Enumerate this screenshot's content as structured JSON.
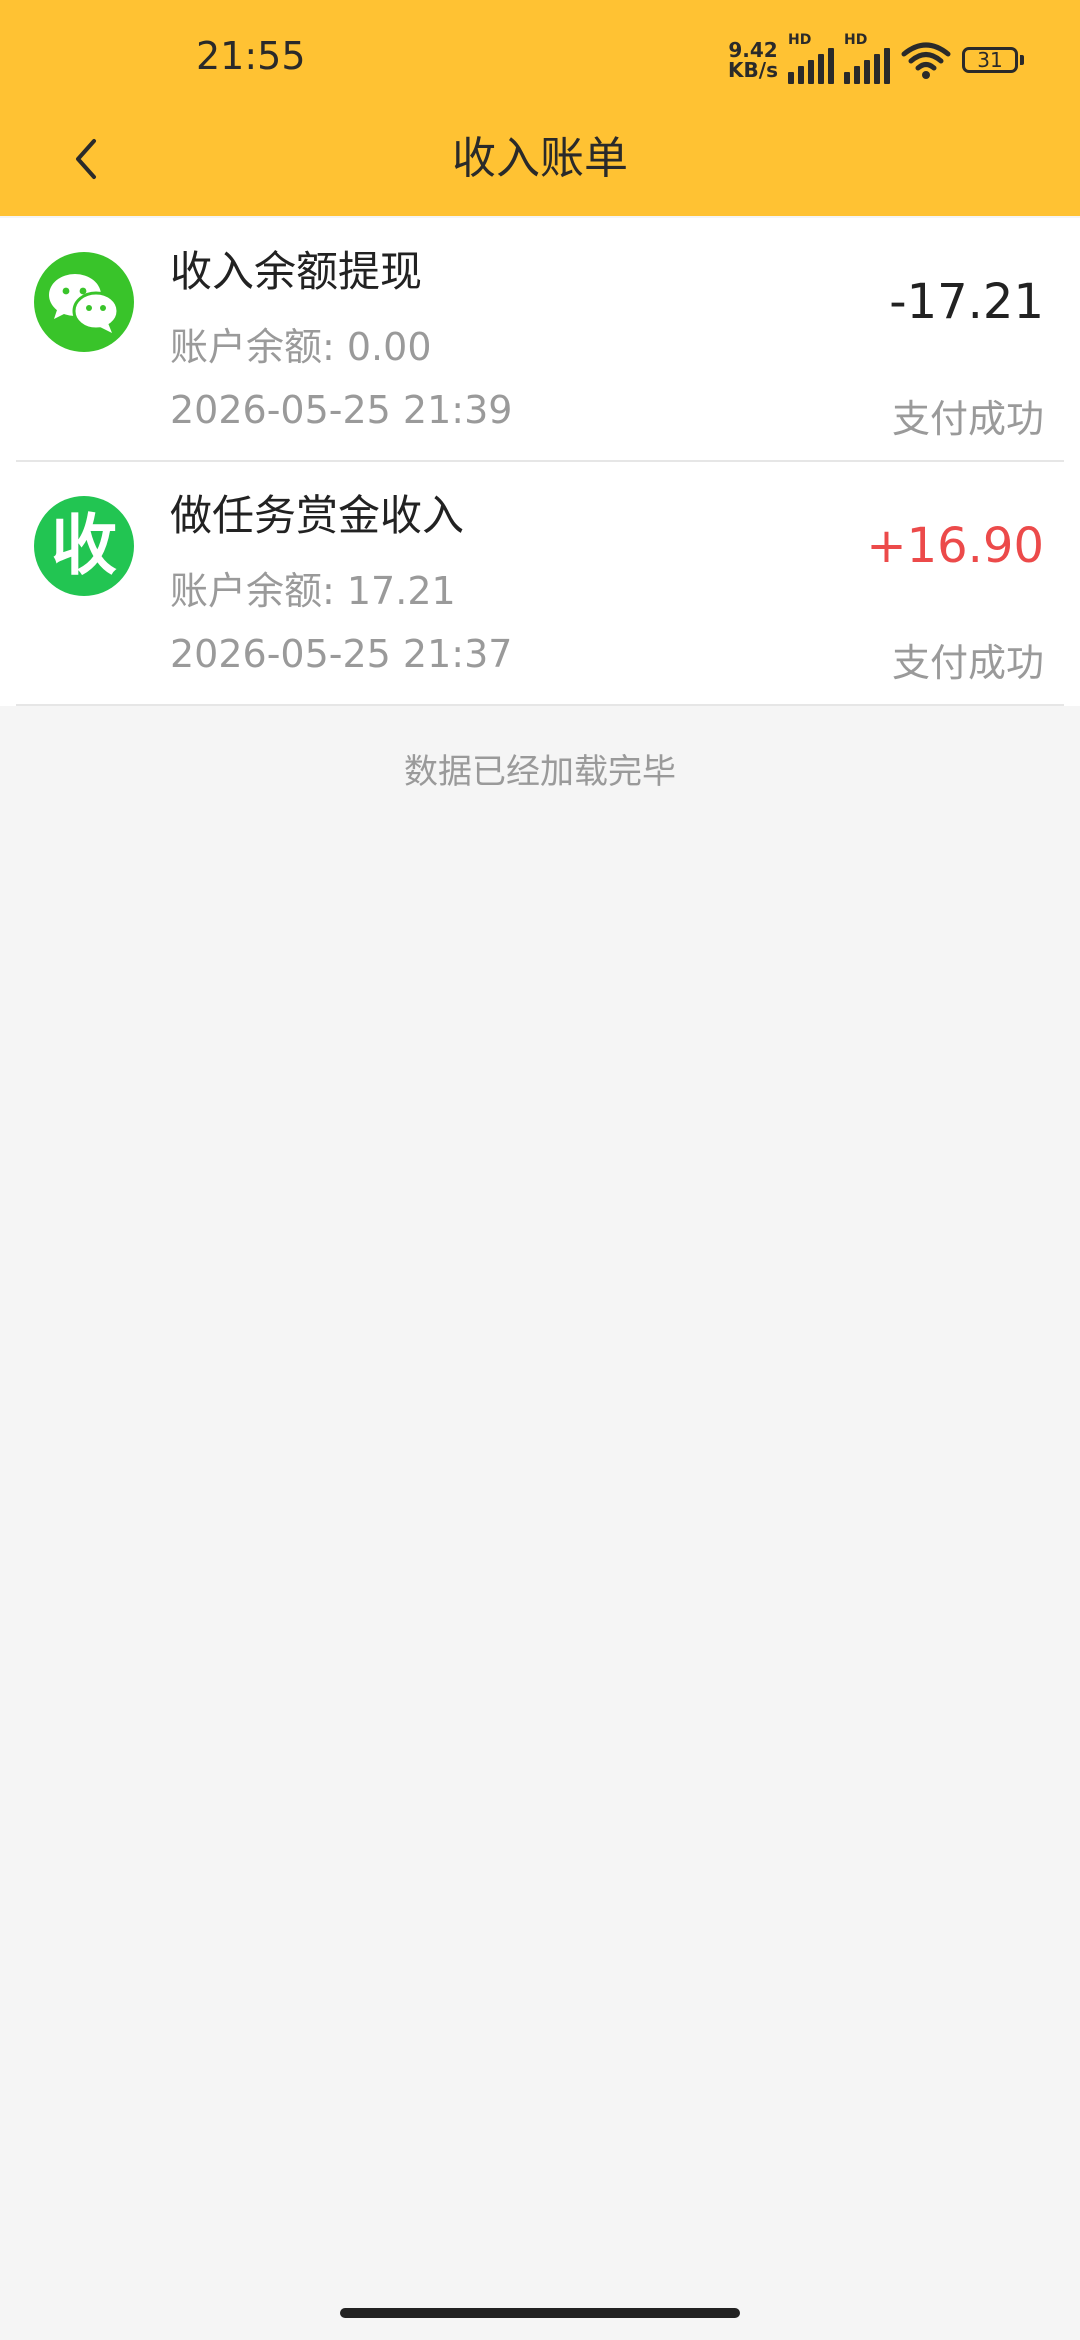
{
  "status_bar": {
    "time": "21:55",
    "net_speed_value": "9.42",
    "net_speed_unit": "KB/s",
    "signal1_label": "HD",
    "signal2_label": "HD",
    "battery": "31",
    "icons": [
      "signal-icon",
      "wifi-icon",
      "battery-icon"
    ]
  },
  "nav": {
    "title": "收入账单",
    "back_icon": "chevron-left-icon"
  },
  "records": [
    {
      "icon": "wechat-icon",
      "title": "收入余额提现",
      "balance": "账户余额: 0.00",
      "time": "2026-05-25 21:39",
      "amount": "-17.21",
      "status": "支付成功"
    },
    {
      "icon": "shou-icon",
      "icon_char": "收",
      "title": "做任务赏金收入",
      "balance": "账户余额: 17.21",
      "time": "2026-05-25 21:37",
      "amount": "+16.90",
      "status": "支付成功"
    }
  ],
  "footer": {
    "end_text": "数据已经加载完毕"
  },
  "colors": {
    "header_bg": "#ffc233",
    "positive_amount": "#ec4a4a",
    "wechat_green": "#39c42a",
    "shou_green": "#22c552"
  }
}
